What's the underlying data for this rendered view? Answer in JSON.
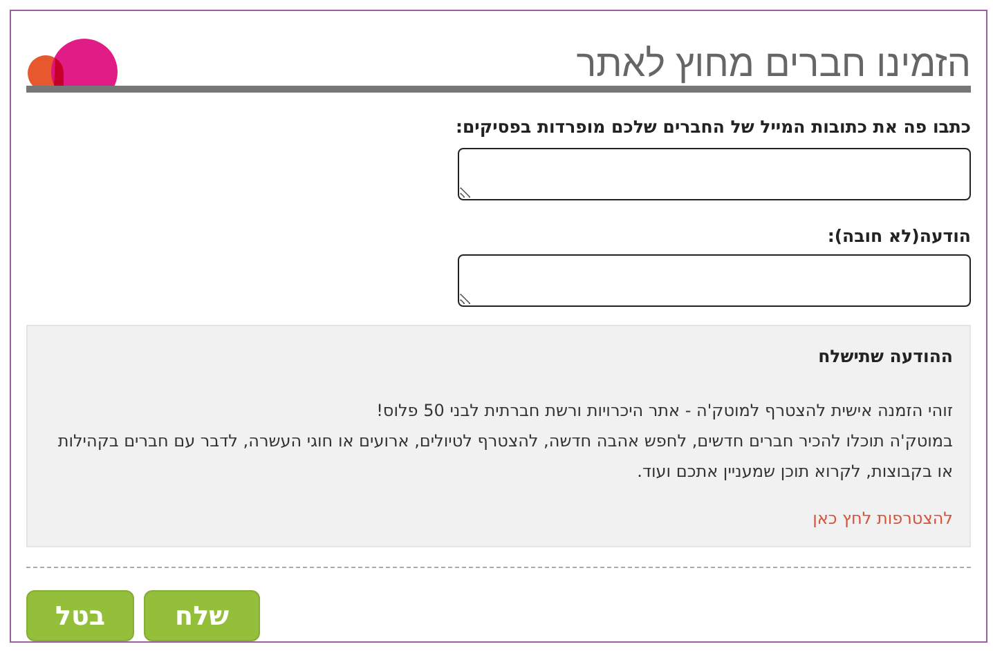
{
  "title": "הזמינו חברים מחוץ לאתר",
  "fields": [
    {
      "label": "כתבו פה את כתובות המייל של החברים שלכם מופרדות בפסיקים:"
    },
    {
      "label": "הודעה(לא חובה):"
    }
  ],
  "preview": {
    "heading": "ההודעה שתישלח",
    "paragraphs": [
      "זוהי הזמנה אישית להצטרף למוטק'ה - אתר היכרויות ורשת חברתית לבני 50 פלוס!",
      "במוטק'ה תוכלו להכיר חברים חדשים, לחפש אהבה חדשה, להצטרף לטיולים, ארועים או חוגי העשרה, לדבר עם חברים בקהילות או בקבוצות, לקרוא תוכן שמעניין אתכם ועוד."
    ],
    "link": "להצטרפות לחץ כאן"
  },
  "buttons": [
    {
      "label": "שלח"
    },
    {
      "label": "בטל"
    }
  ]
}
